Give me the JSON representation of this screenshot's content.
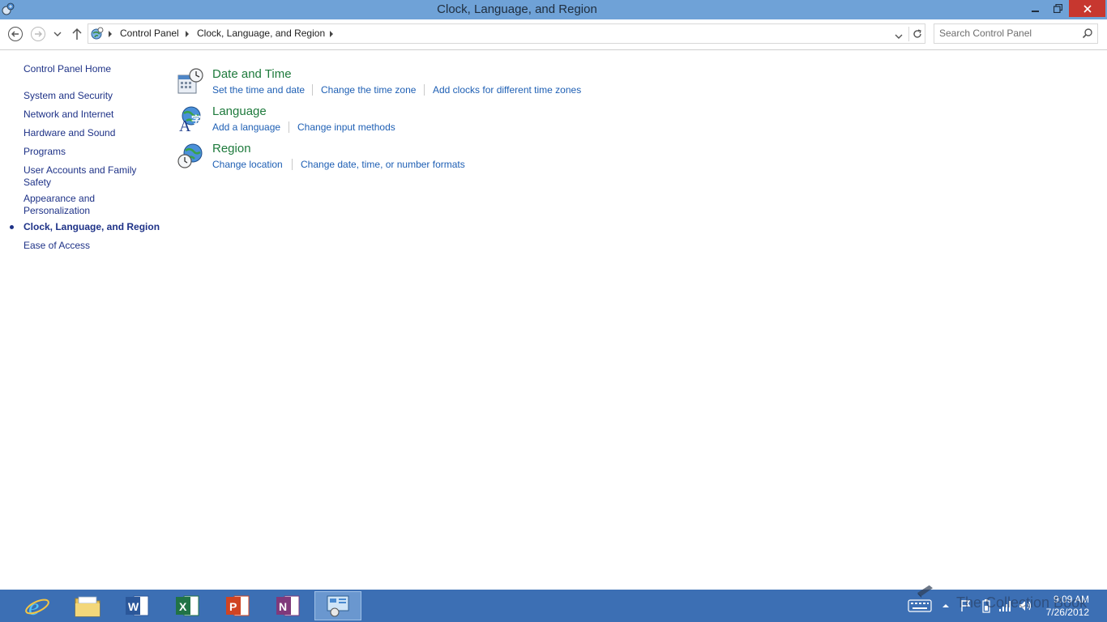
{
  "window": {
    "title": "Clock, Language, and Region",
    "controls": {
      "minimize": "minimize",
      "maximize": "restore",
      "close": "close"
    }
  },
  "address_bar": {
    "breadcrumbs": [
      "Control Panel",
      "Clock, Language, and Region"
    ],
    "search_placeholder": "Search Control Panel"
  },
  "sidebar": {
    "home": "Control Panel Home",
    "items": [
      {
        "label": "System and Security"
      },
      {
        "label": "Network and Internet"
      },
      {
        "label": "Hardware and Sound"
      },
      {
        "label": "Programs"
      },
      {
        "label": "User Accounts and Family Safety"
      },
      {
        "label": "Appearance and Personalization"
      },
      {
        "label": "Clock, Language, and Region",
        "current": true
      },
      {
        "label": "Ease of Access"
      }
    ]
  },
  "categories": [
    {
      "title": "Date and Time",
      "icon": "calendar-clock-icon",
      "links": [
        "Set the time and date",
        "Change the time zone",
        "Add clocks for different time zones"
      ]
    },
    {
      "title": "Language",
      "icon": "globe-language-icon",
      "links": [
        "Add a language",
        "Change input methods"
      ]
    },
    {
      "title": "Region",
      "icon": "globe-clock-icon",
      "links": [
        "Change location",
        "Change date, time, or number formats"
      ]
    }
  ],
  "taskbar": {
    "apps": [
      {
        "name": "Internet Explorer",
        "icon": "ie-icon"
      },
      {
        "name": "File Explorer",
        "icon": "file-explorer-icon"
      },
      {
        "name": "Word",
        "icon": "word-icon"
      },
      {
        "name": "Excel",
        "icon": "excel-icon"
      },
      {
        "name": "PowerPoint",
        "icon": "powerpoint-icon"
      },
      {
        "name": "OneNote",
        "icon": "onenote-icon"
      },
      {
        "name": "Control Panel",
        "icon": "control-panel-icon",
        "active": true
      }
    ],
    "clock": {
      "time": "9:09 AM",
      "date": "7/26/2012"
    },
    "watermark": "The Collection Book"
  },
  "colors": {
    "titlebar": "#6fa2d7",
    "taskbar": "#3c6fb4",
    "close_button": "#c7372f",
    "category_title": "#1e7a3c",
    "link": "#1e5fb4",
    "sidebar_link": "#1e3287"
  }
}
